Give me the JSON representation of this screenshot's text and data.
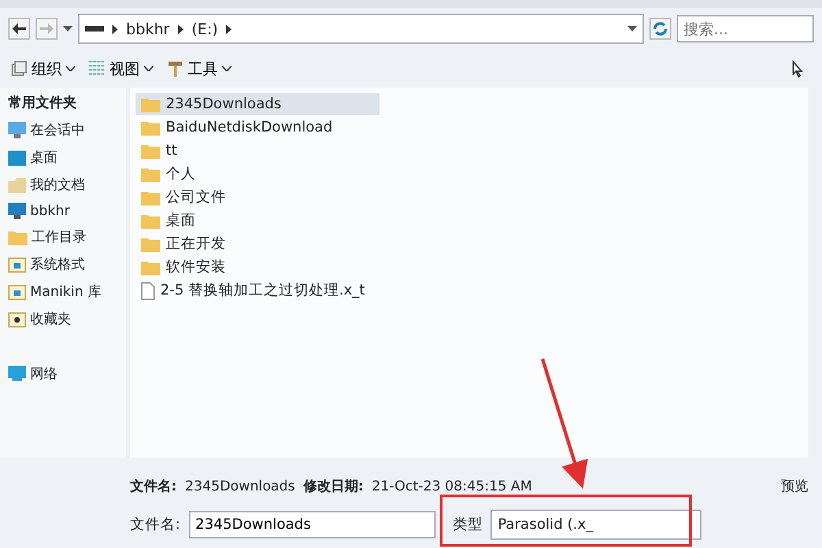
{
  "address_bar": {
    "segments": [
      "bbkhr",
      "(E:)"
    ]
  },
  "search": {
    "placeholder": "搜索..."
  },
  "toolbar": {
    "items": [
      "组织",
      "视图",
      "工具"
    ]
  },
  "sidebar": {
    "heading": "常用文件夹",
    "items": [
      {
        "label": "在会话中",
        "kind": "monitor"
      },
      {
        "label": "桌面",
        "kind": "desktop"
      },
      {
        "label": "我的文档",
        "kind": "documents"
      },
      {
        "label": "bbkhr",
        "kind": "computer"
      },
      {
        "label": "工作目录",
        "kind": "folder"
      },
      {
        "label": "系统格式",
        "kind": "library"
      },
      {
        "label": "Manikin 库",
        "kind": "library"
      },
      {
        "label": "收藏夹",
        "kind": "favorites"
      },
      {
        "label": "网络",
        "kind": "network"
      }
    ]
  },
  "files": [
    {
      "name": "2345Downloads",
      "kind": "folder",
      "selected": true
    },
    {
      "name": "BaiduNetdiskDownload",
      "kind": "folder",
      "selected": false
    },
    {
      "name": "tt",
      "kind": "folder",
      "selected": false
    },
    {
      "name": "个人",
      "kind": "folder",
      "selected": false
    },
    {
      "name": "公司文件",
      "kind": "folder",
      "selected": false
    },
    {
      "name": "桌面",
      "kind": "folder",
      "selected": false
    },
    {
      "name": "正在开发",
      "kind": "folder",
      "selected": false
    },
    {
      "name": "软件安装",
      "kind": "folder",
      "selected": false
    },
    {
      "name": "2-5 替换轴加工之过切处理.x_t",
      "kind": "file",
      "selected": false
    }
  ],
  "details": {
    "name_label": "文件名:",
    "name_value": "2345Downloads",
    "date_label": "修改日期:",
    "date_value": "21-Oct-23 08:45:15 AM",
    "preview": "预览"
  },
  "filename": {
    "label": "文件名:",
    "value": "2345Downloads"
  },
  "filetype": {
    "label": "类型",
    "value": "Parasolid (.x_"
  }
}
